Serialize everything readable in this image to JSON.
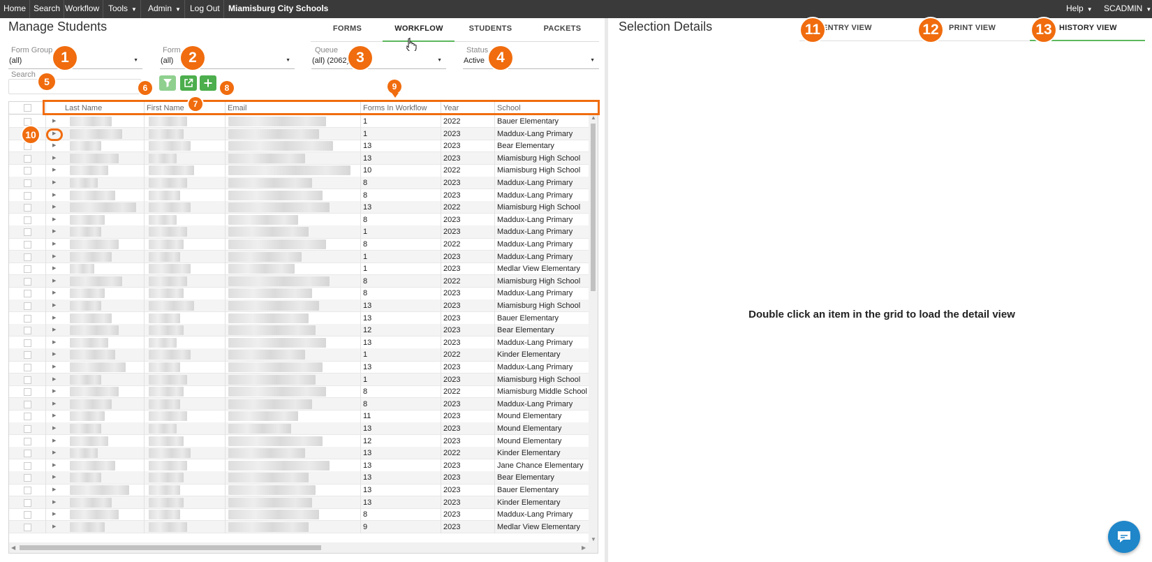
{
  "topbar": {
    "items": [
      {
        "label": "Home",
        "has_caret": false
      },
      {
        "label": "Search",
        "has_caret": false
      },
      {
        "label": "Workflow",
        "has_caret": false
      },
      {
        "label": "Tools",
        "has_caret": true
      },
      {
        "label": "Admin",
        "has_caret": true
      },
      {
        "label": "Log Out",
        "has_caret": false
      }
    ],
    "brand": "Miamisburg City Schools",
    "help": "Help",
    "user": "SCADMIN"
  },
  "left": {
    "title": "Manage Students",
    "tabs": [
      "FORMS",
      "WORKFLOW",
      "STUDENTS",
      "PACKETS"
    ],
    "active_tab": "WORKFLOW",
    "filters": {
      "form_group": {
        "label": "Form Group",
        "value": "(all)"
      },
      "form": {
        "label": "Form",
        "value": "(all)"
      },
      "queue": {
        "label": "Queue",
        "value": "(all) (2062)"
      },
      "status": {
        "label": "Status",
        "value": "Active"
      },
      "search": {
        "label": "Search",
        "value": ""
      }
    },
    "toolbar": {
      "filter_icon": "filter-icon",
      "export_icon": "export-icon",
      "add_icon": "plus-icon"
    }
  },
  "grid": {
    "columns": [
      "Last Name",
      "First Name",
      "Email",
      "Forms In Workflow",
      "Year",
      "School"
    ],
    "rows": [
      {
        "forms": "1",
        "year": "2022",
        "school": "Bauer Elementary"
      },
      {
        "forms": "1",
        "year": "2023",
        "school": "Maddux-Lang Primary"
      },
      {
        "forms": "13",
        "year": "2023",
        "school": "Bear Elementary"
      },
      {
        "forms": "13",
        "year": "2023",
        "school": "Miamisburg High School"
      },
      {
        "forms": "10",
        "year": "2022",
        "school": "Miamisburg High School"
      },
      {
        "forms": "8",
        "year": "2023",
        "school": "Maddux-Lang Primary"
      },
      {
        "forms": "8",
        "year": "2023",
        "school": "Maddux-Lang Primary"
      },
      {
        "forms": "13",
        "year": "2022",
        "school": "Miamisburg High School"
      },
      {
        "forms": "8",
        "year": "2023",
        "school": "Maddux-Lang Primary"
      },
      {
        "forms": "1",
        "year": "2023",
        "school": "Maddux-Lang Primary"
      },
      {
        "forms": "8",
        "year": "2022",
        "school": "Maddux-Lang Primary"
      },
      {
        "forms": "1",
        "year": "2023",
        "school": "Maddux-Lang Primary"
      },
      {
        "forms": "1",
        "year": "2023",
        "school": "Medlar View Elementary"
      },
      {
        "forms": "8",
        "year": "2022",
        "school": "Miamisburg High School"
      },
      {
        "forms": "8",
        "year": "2023",
        "school": "Maddux-Lang Primary"
      },
      {
        "forms": "13",
        "year": "2023",
        "school": "Miamisburg High School"
      },
      {
        "forms": "13",
        "year": "2023",
        "school": "Bauer Elementary"
      },
      {
        "forms": "12",
        "year": "2023",
        "school": "Bear Elementary"
      },
      {
        "forms": "13",
        "year": "2023",
        "school": "Maddux-Lang Primary"
      },
      {
        "forms": "1",
        "year": "2022",
        "school": "Kinder Elementary"
      },
      {
        "forms": "13",
        "year": "2023",
        "school": "Maddux-Lang Primary"
      },
      {
        "forms": "1",
        "year": "2023",
        "school": "Miamisburg High School"
      },
      {
        "forms": "8",
        "year": "2022",
        "school": "Miamisburg Middle School"
      },
      {
        "forms": "8",
        "year": "2023",
        "school": "Maddux-Lang Primary"
      },
      {
        "forms": "11",
        "year": "2023",
        "school": "Mound Elementary"
      },
      {
        "forms": "13",
        "year": "2023",
        "school": "Mound Elementary"
      },
      {
        "forms": "12",
        "year": "2023",
        "school": "Mound Elementary"
      },
      {
        "forms": "13",
        "year": "2022",
        "school": "Kinder Elementary"
      },
      {
        "forms": "13",
        "year": "2023",
        "school": "Jane Chance Elementary"
      },
      {
        "forms": "13",
        "year": "2023",
        "school": "Bear Elementary"
      },
      {
        "forms": "13",
        "year": "2023",
        "school": "Bauer Elementary"
      },
      {
        "forms": "13",
        "year": "2023",
        "school": "Kinder Elementary"
      },
      {
        "forms": "8",
        "year": "2023",
        "school": "Maddux-Lang Primary"
      },
      {
        "forms": "9",
        "year": "2023",
        "school": "Medlar View Elementary"
      }
    ]
  },
  "right": {
    "title": "Selection Details",
    "tabs": [
      "ENTRY VIEW",
      "PRINT VIEW",
      "HISTORY VIEW"
    ],
    "active_tab": "HISTORY VIEW",
    "empty_message": "Double click an item in the grid to load the detail view"
  },
  "annotations": [
    "1",
    "2",
    "3",
    "4",
    "5",
    "6",
    "7",
    "8",
    "9",
    "10",
    "11",
    "12",
    "13"
  ],
  "colors": {
    "accent_orange": "#f06c0e",
    "green": "#5cb85c",
    "nav_bg": "#3a3a3a",
    "chat_blue": "#1f86c9"
  },
  "chat_icon": "chat-bubble-icon"
}
